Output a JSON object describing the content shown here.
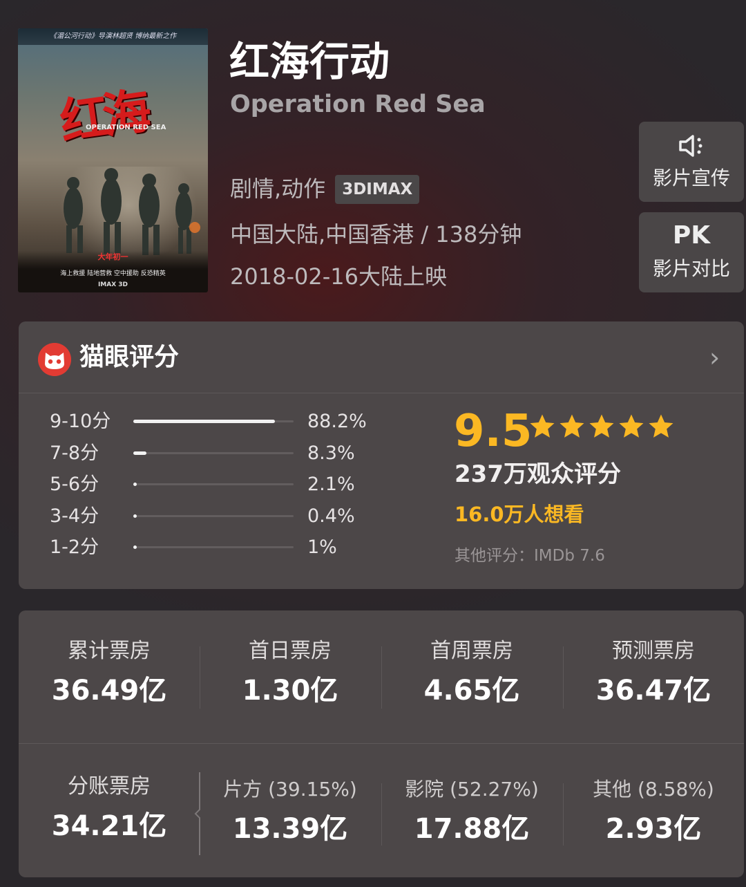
{
  "movie": {
    "title_cn": "红海行动",
    "title_en": "Operation Red Sea",
    "genre": "剧情,动作",
    "format_tag": "3DIMAX",
    "region_duration": "中国大陆,中国香港 / 138分钟",
    "release": "2018-02-16大陆上映"
  },
  "poster": {
    "top_text": "《湄公河行动》导演林超贤 博纳最新之作",
    "title": "红海",
    "subtitle_en": "OPERATION RED SEA",
    "date_text": "大年初一",
    "cast_text": "海上救援 陆地营救 空中援助 反恐精英",
    "imax_text": "IMAX 3D"
  },
  "side_buttons": [
    {
      "icon": "speaker-icon",
      "label": "影片宣传"
    },
    {
      "icon_text": "PK",
      "label": "影片对比"
    }
  ],
  "rating": {
    "header": "猫眼评分",
    "distribution": [
      {
        "range": "9-10分",
        "percent": "88.2%",
        "value": 0.882
      },
      {
        "range": "7-8分",
        "percent": "8.3%",
        "value": 0.083
      },
      {
        "range": "5-6分",
        "percent": "2.1%",
        "value": 0.021
      },
      {
        "range": "3-4分",
        "percent": "0.4%",
        "value": 0.004
      },
      {
        "range": "1-2分",
        "percent": "1%",
        "value": 0.01
      }
    ],
    "score": "9.5",
    "stars": 5,
    "voters": "237万观众评分",
    "want_to_see": "16.0万人想看",
    "other": "其他评分：IMDb 7.6"
  },
  "boxoffice": {
    "row1": [
      {
        "label": "累计票房",
        "value": "36.49亿"
      },
      {
        "label": "首日票房",
        "value": "1.30亿"
      },
      {
        "label": "首周票房",
        "value": "4.65亿"
      },
      {
        "label": "预测票房",
        "value": "36.47亿"
      }
    ],
    "split": {
      "label": "分账票房",
      "value": "34.21亿"
    },
    "row2": [
      {
        "label": "片方 (39.15%)",
        "value": "13.39亿"
      },
      {
        "label": "影院 (52.27%)",
        "value": "17.88亿"
      },
      {
        "label": "其他 (8.58%)",
        "value": "2.93亿"
      }
    ]
  },
  "colors": {
    "accent": "#fbb823",
    "brand_red": "#e23b33",
    "card": "#4c4748"
  }
}
